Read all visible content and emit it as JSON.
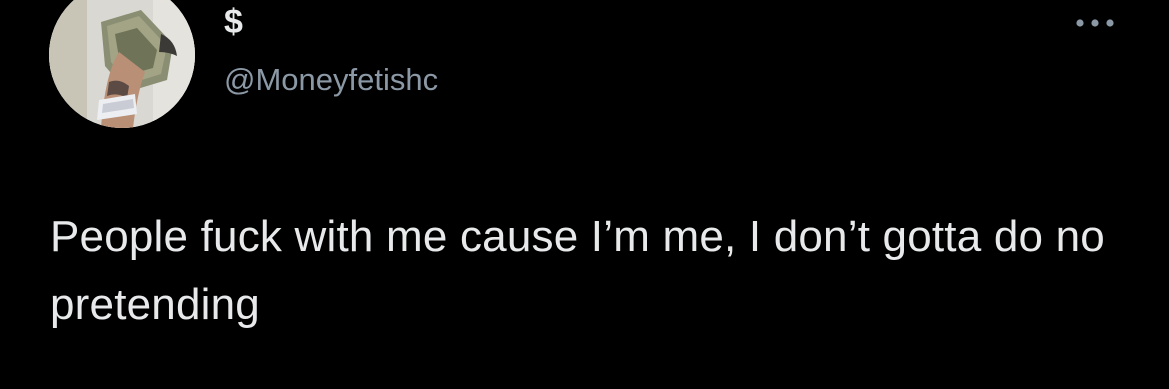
{
  "tweet": {
    "author": {
      "display_name": "$",
      "handle": "@Moneyfetishc",
      "avatar_icon": "profile-photo-hand-holding-cash"
    },
    "menu_icon": "more-horizontal-icon",
    "text": "People fuck with me cause I’m me, I don’t gotta do no pretending"
  },
  "colors": {
    "background": "#000000",
    "primary_text": "#e7e9ea",
    "secondary_text": "#8b98a5"
  }
}
